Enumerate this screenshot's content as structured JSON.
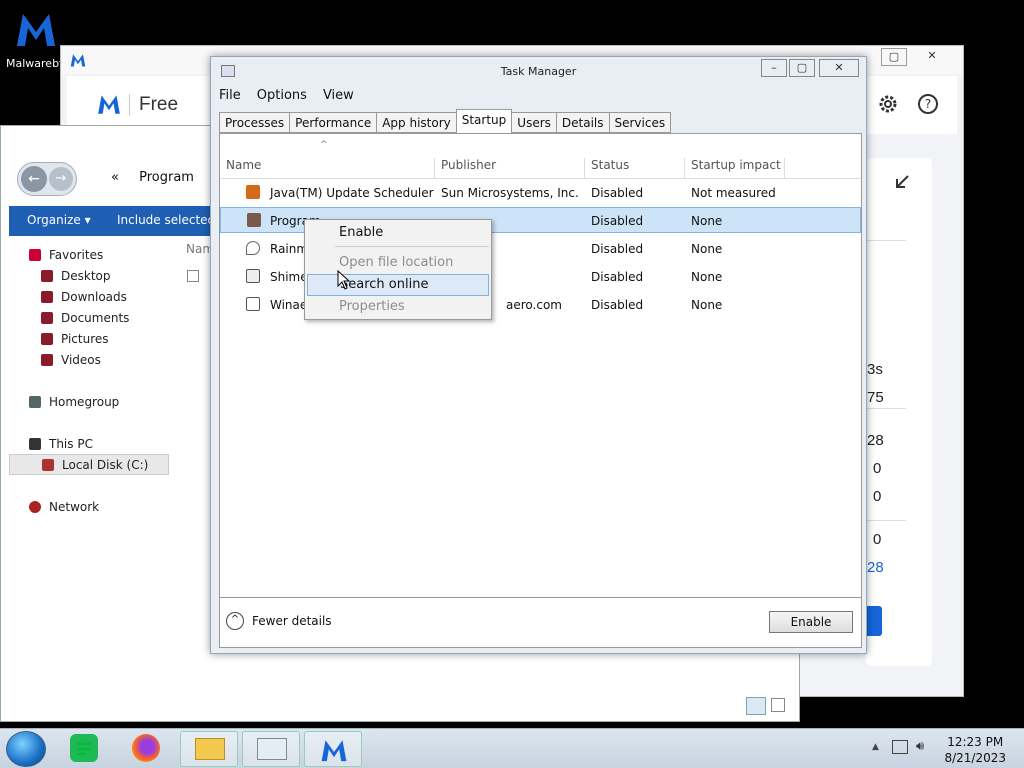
{
  "desktop": {
    "icon_label": "Malwarebyt"
  },
  "malwarebytes": {
    "brand": "Free",
    "side_values": [
      "3s",
      "75",
      "28",
      "0",
      "0",
      "0",
      "28"
    ]
  },
  "explorer": {
    "path": "Program",
    "organize": "Organize",
    "include": "Include selected",
    "col_name": "Nam",
    "favorites": "Favorites",
    "fav_items": [
      "Desktop",
      "Downloads",
      "Documents",
      "Pictures",
      "Videos"
    ],
    "homegroup": "Homegroup",
    "this_pc": "This PC",
    "local_disk": "Local Disk (C:)",
    "network": "Network"
  },
  "taskmanager": {
    "title": "Task Manager",
    "menu": [
      "File",
      "Options",
      "View"
    ],
    "tabs": [
      "Processes",
      "Performance",
      "App history",
      "Startup",
      "Users",
      "Details",
      "Services"
    ],
    "columns": [
      "Name",
      "Publisher",
      "Status",
      "Startup impact"
    ],
    "rows": [
      {
        "name": "Java(TM) Update Scheduler",
        "publisher": "Sun Microsystems, Inc.",
        "status": "Disabled",
        "impact": "Not measured"
      },
      {
        "name": "Program",
        "publisher": "",
        "status": "Disabled",
        "impact": "None"
      },
      {
        "name": "Rainm",
        "publisher": "",
        "status": "Disabled",
        "impact": "None"
      },
      {
        "name": "Shimej",
        "publisher": "",
        "status": "Disabled",
        "impact": "None"
      },
      {
        "name": "Winaer",
        "publisher": "aero.com",
        "status": "Disabled",
        "impact": "None"
      }
    ],
    "fewer_details": "Fewer details",
    "enable_button": "Enable"
  },
  "context_menu": {
    "items": [
      "Enable",
      "Open file location",
      "Search online",
      "Properties"
    ]
  },
  "taskbar": {
    "time": "12:23 PM",
    "date": "8/21/2023"
  },
  "colors": {
    "accent": "#1e5fb3",
    "mb_blue": "#1666d9"
  }
}
